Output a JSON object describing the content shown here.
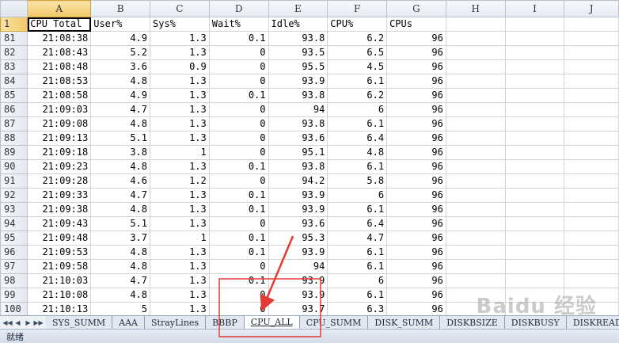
{
  "columns": [
    "A",
    "B",
    "C",
    "D",
    "E",
    "F",
    "G",
    "H",
    "I",
    "J"
  ],
  "selected_column": "A",
  "header_row": {
    "row_number": "1",
    "cells": [
      "CPU Total",
      "User%",
      "Sys%",
      "Wait%",
      "Idle%",
      "CPU%",
      "CPUs",
      "",
      "",
      ""
    ]
  },
  "rows": [
    {
      "n": "81",
      "cells": [
        "21:08:38",
        "4.9",
        "1.3",
        "0.1",
        "93.8",
        "6.2",
        "96"
      ]
    },
    {
      "n": "82",
      "cells": [
        "21:08:43",
        "5.2",
        "1.3",
        "0",
        "93.5",
        "6.5",
        "96"
      ]
    },
    {
      "n": "83",
      "cells": [
        "21:08:48",
        "3.6",
        "0.9",
        "0",
        "95.5",
        "4.5",
        "96"
      ]
    },
    {
      "n": "84",
      "cells": [
        "21:08:53",
        "4.8",
        "1.3",
        "0",
        "93.9",
        "6.1",
        "96"
      ]
    },
    {
      "n": "85",
      "cells": [
        "21:08:58",
        "4.9",
        "1.3",
        "0.1",
        "93.8",
        "6.2",
        "96"
      ]
    },
    {
      "n": "86",
      "cells": [
        "21:09:03",
        "4.7",
        "1.3",
        "0",
        "94",
        "6",
        "96"
      ]
    },
    {
      "n": "87",
      "cells": [
        "21:09:08",
        "4.8",
        "1.3",
        "0",
        "93.8",
        "6.1",
        "96"
      ]
    },
    {
      "n": "88",
      "cells": [
        "21:09:13",
        "5.1",
        "1.3",
        "0",
        "93.6",
        "6.4",
        "96"
      ]
    },
    {
      "n": "89",
      "cells": [
        "21:09:18",
        "3.8",
        "1",
        "0",
        "95.1",
        "4.8",
        "96"
      ]
    },
    {
      "n": "90",
      "cells": [
        "21:09:23",
        "4.8",
        "1.3",
        "0.1",
        "93.8",
        "6.1",
        "96"
      ]
    },
    {
      "n": "91",
      "cells": [
        "21:09:28",
        "4.6",
        "1.2",
        "0",
        "94.2",
        "5.8",
        "96"
      ]
    },
    {
      "n": "92",
      "cells": [
        "21:09:33",
        "4.7",
        "1.3",
        "0.1",
        "93.9",
        "6",
        "96"
      ]
    },
    {
      "n": "93",
      "cells": [
        "21:09:38",
        "4.8",
        "1.3",
        "0.1",
        "93.9",
        "6.1",
        "96"
      ]
    },
    {
      "n": "94",
      "cells": [
        "21:09:43",
        "5.1",
        "1.3",
        "0",
        "93.6",
        "6.4",
        "96"
      ]
    },
    {
      "n": "95",
      "cells": [
        "21:09:48",
        "3.7",
        "1",
        "0.1",
        "95.3",
        "4.7",
        "96"
      ]
    },
    {
      "n": "96",
      "cells": [
        "21:09:53",
        "4.8",
        "1.3",
        "0.1",
        "93.9",
        "6.1",
        "96"
      ]
    },
    {
      "n": "97",
      "cells": [
        "21:09:58",
        "4.8",
        "1.3",
        "0",
        "94",
        "6.1",
        "96"
      ]
    },
    {
      "n": "98",
      "cells": [
        "21:10:03",
        "4.7",
        "1.3",
        "0.1",
        "93.9",
        "6",
        "96"
      ]
    },
    {
      "n": "99",
      "cells": [
        "21:10:08",
        "4.8",
        "1.3",
        "0",
        "93.9",
        "6.1",
        "96"
      ]
    },
    {
      "n": "100",
      "cells": [
        "21:10:13",
        "5",
        "1.3",
        "0",
        "93.7",
        "6.3",
        "96"
      ]
    }
  ],
  "sheet_tabs": [
    "SYS_SUMM",
    "AAA",
    "StrayLines",
    "BBBP",
    "CPU_ALL",
    "CPU_SUMM",
    "DISK_SUMM",
    "DISKBSIZE",
    "DISKBUSY",
    "DISKREAD"
  ],
  "active_tab": "CPU_ALL",
  "status": {
    "text": "就绪"
  },
  "annotation": {
    "color": "#e53935"
  },
  "watermark": {
    "text": "Baidu 经验"
  }
}
